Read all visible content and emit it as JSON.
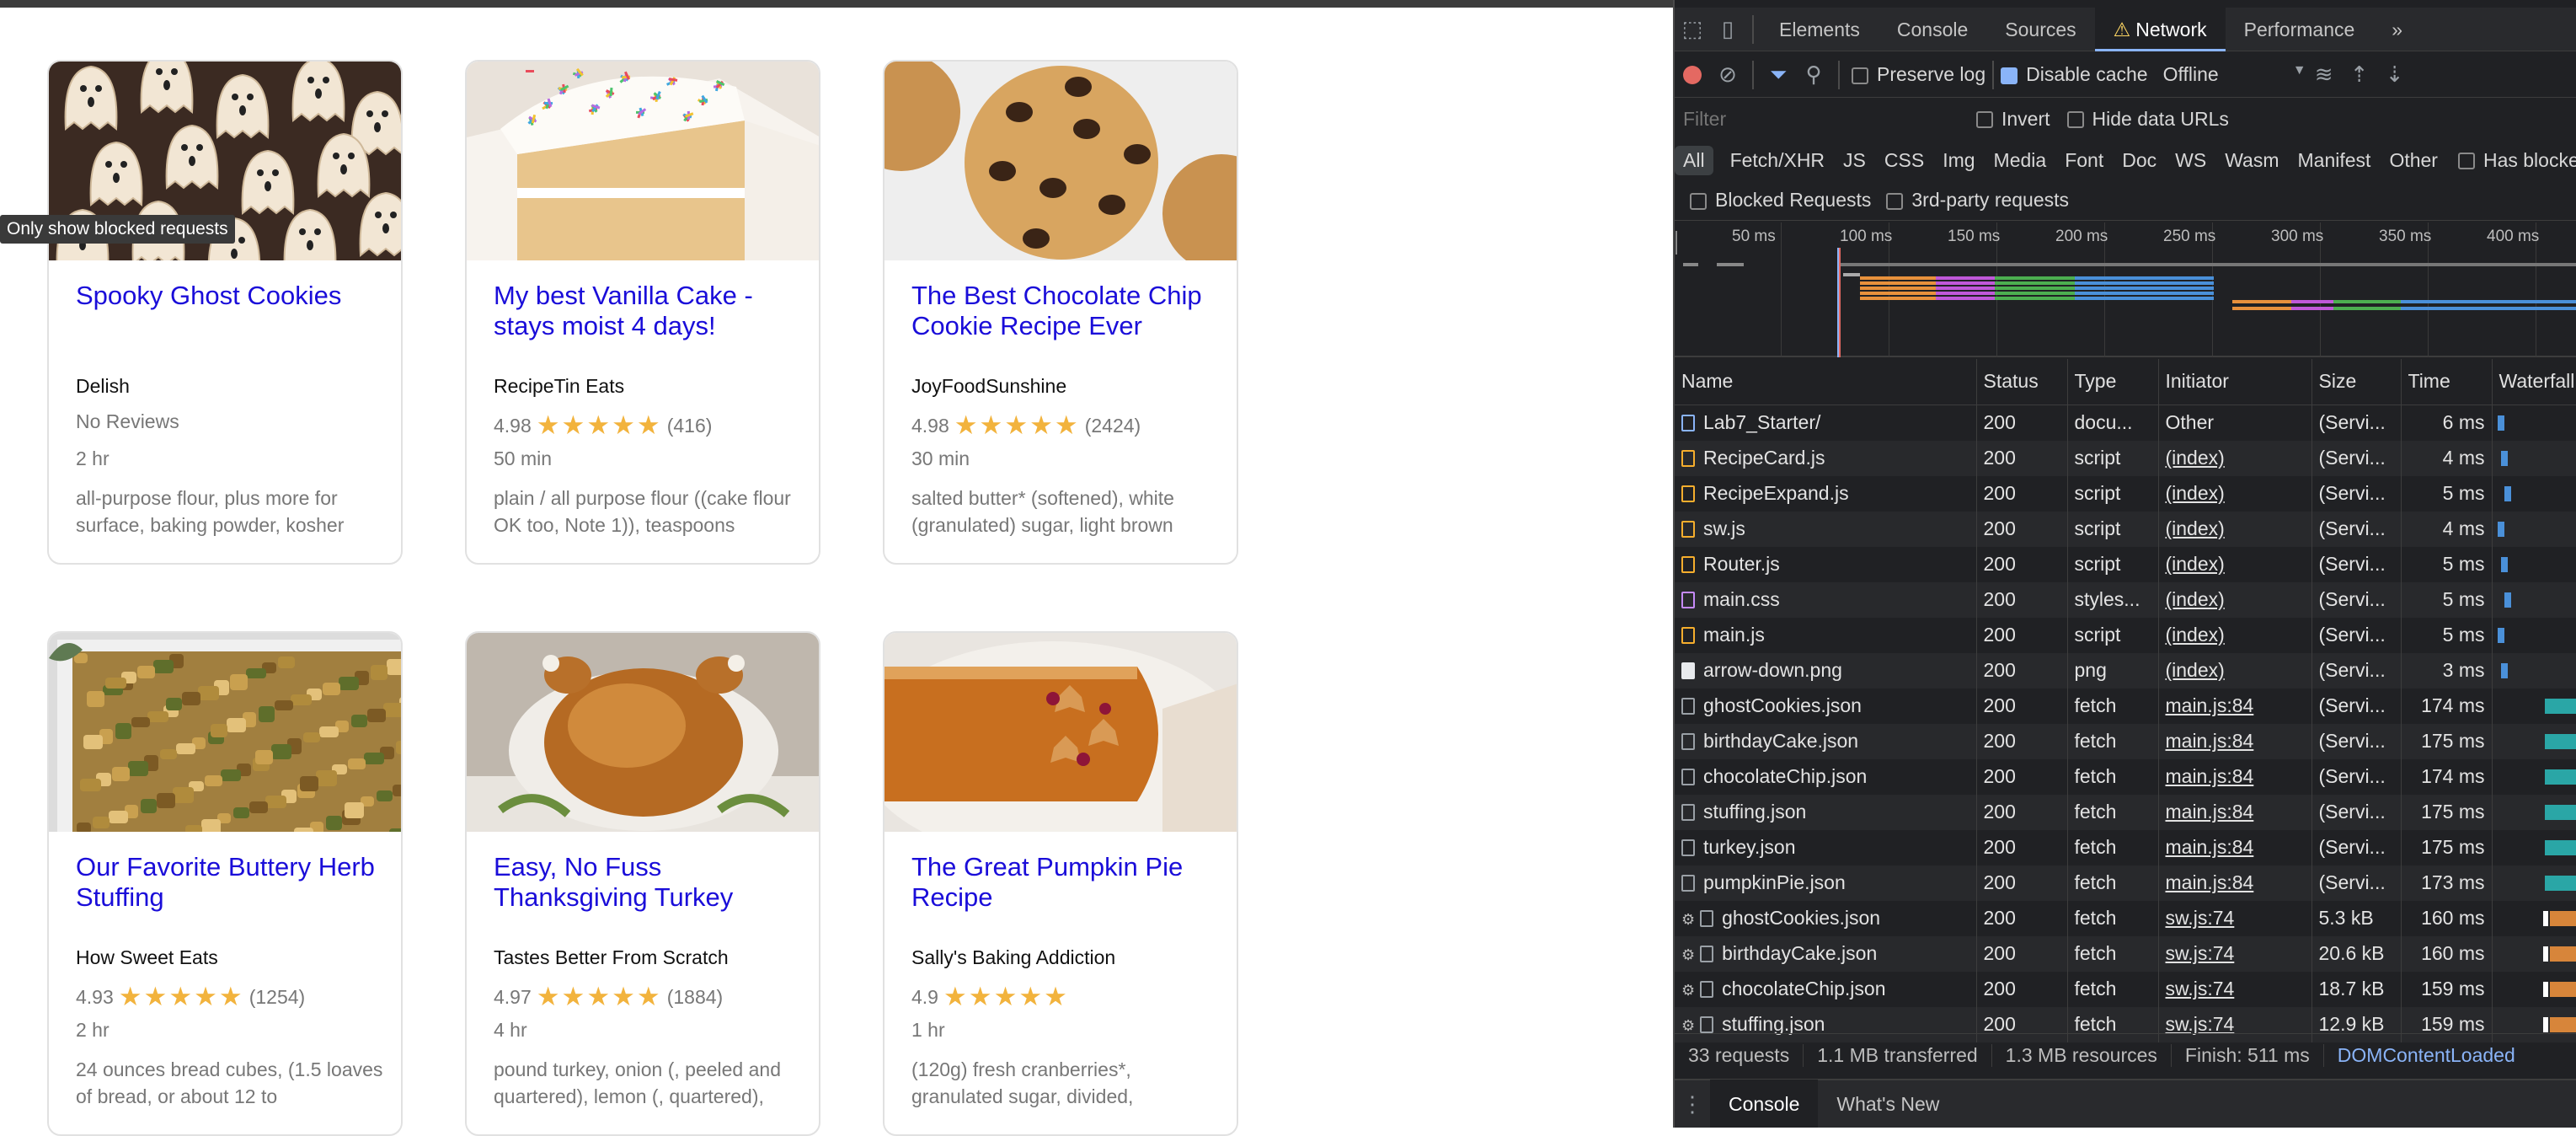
{
  "tooltip": "Only show blocked requests",
  "recipes": [
    {
      "title": "Spooky Ghost Cookies",
      "org": "Delish",
      "rating": "",
      "stars": "",
      "count": "",
      "no_reviews": "No Reviews",
      "time": "2 hr",
      "ingredients": "all-purpose flour, plus more for surface, baking powder, kosher"
    },
    {
      "title": "My best Vanilla Cake - stays moist 4 days!",
      "org": "RecipeTin Eats",
      "rating": "4.98",
      "stars": "★★★★★",
      "count": "(416)",
      "no_reviews": "",
      "time": "50 min",
      "ingredients": "plain / all purpose flour ((cake flour OK too, Note 1)), teaspoons"
    },
    {
      "title": "The Best Chocolate Chip Cookie Recipe Ever",
      "org": "JoyFoodSunshine",
      "rating": "4.98",
      "stars": "★★★★★",
      "count": "(2424)",
      "no_reviews": "",
      "time": "30 min",
      "ingredients": "salted butter* (softened), white (granulated) sugar, light brown"
    },
    {
      "title": "Our Favorite Buttery Herb Stuffing",
      "org": "How Sweet Eats",
      "rating": "4.93",
      "stars": "★★★★★",
      "count": "(1254)",
      "no_reviews": "",
      "time": "2 hr",
      "ingredients": "24 ounces bread cubes, (1.5 loaves of bread, or about 12 to"
    },
    {
      "title": "Easy, No Fuss Thanksgiving Turkey",
      "org": "Tastes Better From Scratch",
      "rating": "4.97",
      "stars": "★★★★★",
      "count": "(1884)",
      "no_reviews": "",
      "time": "4 hr",
      "ingredients": "pound turkey, onion (, peeled and quartered), lemon (, quartered),"
    },
    {
      "title": "The Great Pumpkin Pie Recipe",
      "org": "Sally's Baking Addiction",
      "rating": "4.9",
      "stars": "★★★★★",
      "count": "",
      "no_reviews": "",
      "time": "1 hr",
      "ingredients": "(120g) fresh cranberries*, granulated sugar, divided,"
    }
  ],
  "devtools": {
    "tabs": [
      "Elements",
      "Console",
      "Sources",
      "Network",
      "Performance"
    ],
    "more_tabs": "»",
    "warning_icon": "⚠",
    "preserve_log": "Preserve log",
    "disable_cache": "Disable cache",
    "throttle": "Offline",
    "filter_placeholder": "Filter",
    "invert": "Invert",
    "hide_data_urls": "Hide data URLs",
    "types": [
      "All",
      "Fetch/XHR",
      "JS",
      "CSS",
      "Img",
      "Media",
      "Font",
      "Doc",
      "WS",
      "Wasm",
      "Manifest",
      "Other"
    ],
    "has_blocked": "Has blocked cookies",
    "blocked_requests": "Blocked Requests",
    "third_party": "3rd-party requests",
    "ticks": [
      "50 ms",
      "100 ms",
      "150 ms",
      "200 ms",
      "250 ms",
      "300 ms",
      "350 ms",
      "400 ms"
    ],
    "columns": [
      "Name",
      "Status",
      "Type",
      "Initiator",
      "Size",
      "Time",
      "Waterfall"
    ],
    "rows": [
      {
        "name": "Lab7_Starter/",
        "icon": "doc",
        "status": "200",
        "type": "docu...",
        "initiator": "Other",
        "size": "(Servi...",
        "time": "6 ms",
        "sw": false
      },
      {
        "name": "RecipeCard.js",
        "icon": "script",
        "status": "200",
        "type": "script",
        "initiator": "(index)",
        "size": "(Servi...",
        "time": "4 ms",
        "sw": false
      },
      {
        "name": "RecipeExpand.js",
        "icon": "script",
        "status": "200",
        "type": "script",
        "initiator": "(index)",
        "size": "(Servi...",
        "time": "5 ms",
        "sw": false
      },
      {
        "name": "sw.js",
        "icon": "script",
        "status": "200",
        "type": "script",
        "initiator": "(index)",
        "size": "(Servi...",
        "time": "4 ms",
        "sw": false
      },
      {
        "name": "Router.js",
        "icon": "script",
        "status": "200",
        "type": "script",
        "initiator": "(index)",
        "size": "(Servi...",
        "time": "5 ms",
        "sw": false
      },
      {
        "name": "main.css",
        "icon": "css",
        "status": "200",
        "type": "styles...",
        "initiator": "(index)",
        "size": "(Servi...",
        "time": "5 ms",
        "sw": false
      },
      {
        "name": "main.js",
        "icon": "script",
        "status": "200",
        "type": "script",
        "initiator": "(index)",
        "size": "(Servi...",
        "time": "5 ms",
        "sw": false
      },
      {
        "name": "arrow-down.png",
        "icon": "img",
        "status": "200",
        "type": "png",
        "initiator": "(index)",
        "size": "(Servi...",
        "time": "3 ms",
        "sw": false
      },
      {
        "name": "ghostCookies.json",
        "icon": "fetch",
        "status": "200",
        "type": "fetch",
        "initiator": "main.js:84",
        "size": "(Servi...",
        "time": "174 ms",
        "sw": false
      },
      {
        "name": "birthdayCake.json",
        "icon": "fetch",
        "status": "200",
        "type": "fetch",
        "initiator": "main.js:84",
        "size": "(Servi...",
        "time": "175 ms",
        "sw": false
      },
      {
        "name": "chocolateChip.json",
        "icon": "fetch",
        "status": "200",
        "type": "fetch",
        "initiator": "main.js:84",
        "size": "(Servi...",
        "time": "174 ms",
        "sw": false
      },
      {
        "name": "stuffing.json",
        "icon": "fetch",
        "status": "200",
        "type": "fetch",
        "initiator": "main.js:84",
        "size": "(Servi...",
        "time": "175 ms",
        "sw": false
      },
      {
        "name": "turkey.json",
        "icon": "fetch",
        "status": "200",
        "type": "fetch",
        "initiator": "main.js:84",
        "size": "(Servi...",
        "time": "175 ms",
        "sw": false
      },
      {
        "name": "pumpkinPie.json",
        "icon": "fetch",
        "status": "200",
        "type": "fetch",
        "initiator": "main.js:84",
        "size": "(Servi...",
        "time": "173 ms",
        "sw": false
      },
      {
        "name": "ghostCookies.json",
        "icon": "fetch",
        "status": "200",
        "type": "fetch",
        "initiator": "sw.js:74",
        "size": "5.3 kB",
        "time": "160 ms",
        "sw": true
      },
      {
        "name": "birthdayCake.json",
        "icon": "fetch",
        "status": "200",
        "type": "fetch",
        "initiator": "sw.js:74",
        "size": "20.6 kB",
        "time": "160 ms",
        "sw": true
      },
      {
        "name": "chocolateChip.json",
        "icon": "fetch",
        "status": "200",
        "type": "fetch",
        "initiator": "sw.js:74",
        "size": "18.7 kB",
        "time": "159 ms",
        "sw": true
      },
      {
        "name": "stuffing.json",
        "icon": "fetch",
        "status": "200",
        "type": "fetch",
        "initiator": "sw.js:74",
        "size": "12.9 kB",
        "time": "159 ms",
        "sw": true
      }
    ],
    "summary": [
      "33 requests",
      "1.1 MB transferred",
      "1.3 MB resources",
      "Finish: 511 ms",
      "DOMContentLoaded"
    ],
    "drawer_tabs": [
      "Console",
      "What's New"
    ],
    "colors": {
      "accent": "#8ab4f8",
      "link": "#1a0dd9",
      "star": "#f2b33d",
      "record": "#e46962"
    }
  }
}
